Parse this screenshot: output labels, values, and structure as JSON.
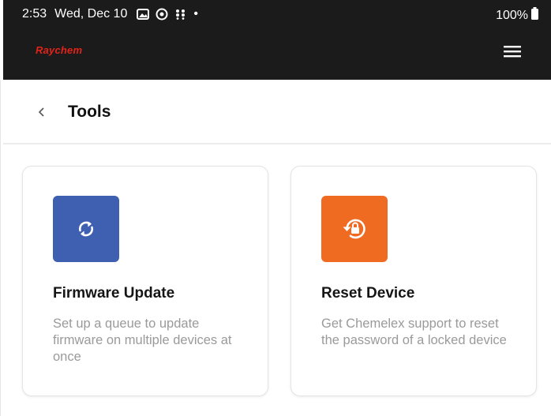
{
  "status_bar": {
    "time": "2:53",
    "date": "Wed, Dec 10",
    "dot": "•",
    "battery_text": "100%",
    "icons": [
      "image-icon",
      "record-icon",
      "dots-icon",
      "battery-icon"
    ]
  },
  "app_bar": {
    "brand": "Raychem",
    "brand_color": "#e2231a",
    "menu_icon": "hamburger-menu-icon"
  },
  "page": {
    "back_icon": "chevron-left-icon",
    "title": "Tools"
  },
  "cards": [
    {
      "title": "Firmware Update",
      "description": "Set up a queue to update firmware on multiple devices at once",
      "icon": "sync-icon",
      "icon_bg": "#3f5fb0"
    },
    {
      "title": "Reset Device",
      "description": "Get Chemelex support to reset the password of a locked device",
      "icon": "lock-reset-icon",
      "icon_bg": "#f06b22"
    }
  ]
}
